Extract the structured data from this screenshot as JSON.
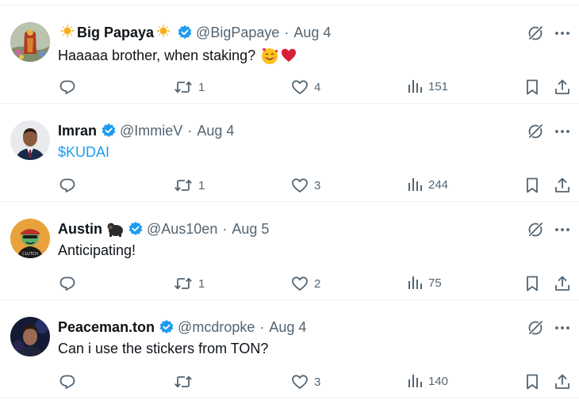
{
  "colors": {
    "accent": "#1d9bf0",
    "muted": "#536471",
    "text": "#0f1419",
    "divider": "#eff3f4"
  },
  "tweets": [
    {
      "name": "Big Papaya",
      "name_prefix_icon": "sun-emoji-icon",
      "name_suffix_icon": "sun-emoji-icon",
      "verified": true,
      "handle": "@BigPapaye",
      "date": "Aug 4",
      "text": "Haaaaa brother, when staking?",
      "text_emojis": [
        "smiling-face-with-hearts-emoji-icon",
        "red-heart-emoji-icon"
      ],
      "replies": "",
      "retweets": "1",
      "likes": "4",
      "views": "151"
    },
    {
      "name": "Imran",
      "verified": true,
      "handle": "@ImmieV",
      "date": "Aug 4",
      "text": "$KUDAI",
      "text_is_link": true,
      "replies": "",
      "retweets": "1",
      "likes": "3",
      "views": "244"
    },
    {
      "name": "Austin",
      "name_suffix_icon": "gorilla-emoji-icon",
      "verified": true,
      "handle": "@Aus10en",
      "date": "Aug 5",
      "text": "Anticipating!",
      "replies": "",
      "retweets": "1",
      "likes": "2",
      "views": "75"
    },
    {
      "name": "Peaceman.ton",
      "verified": true,
      "handle": "@mcdropke",
      "date": "Aug 4",
      "text": "Can i use the stickers from TON?",
      "replies": "",
      "retweets": "",
      "likes": "3",
      "views": "140"
    }
  ]
}
